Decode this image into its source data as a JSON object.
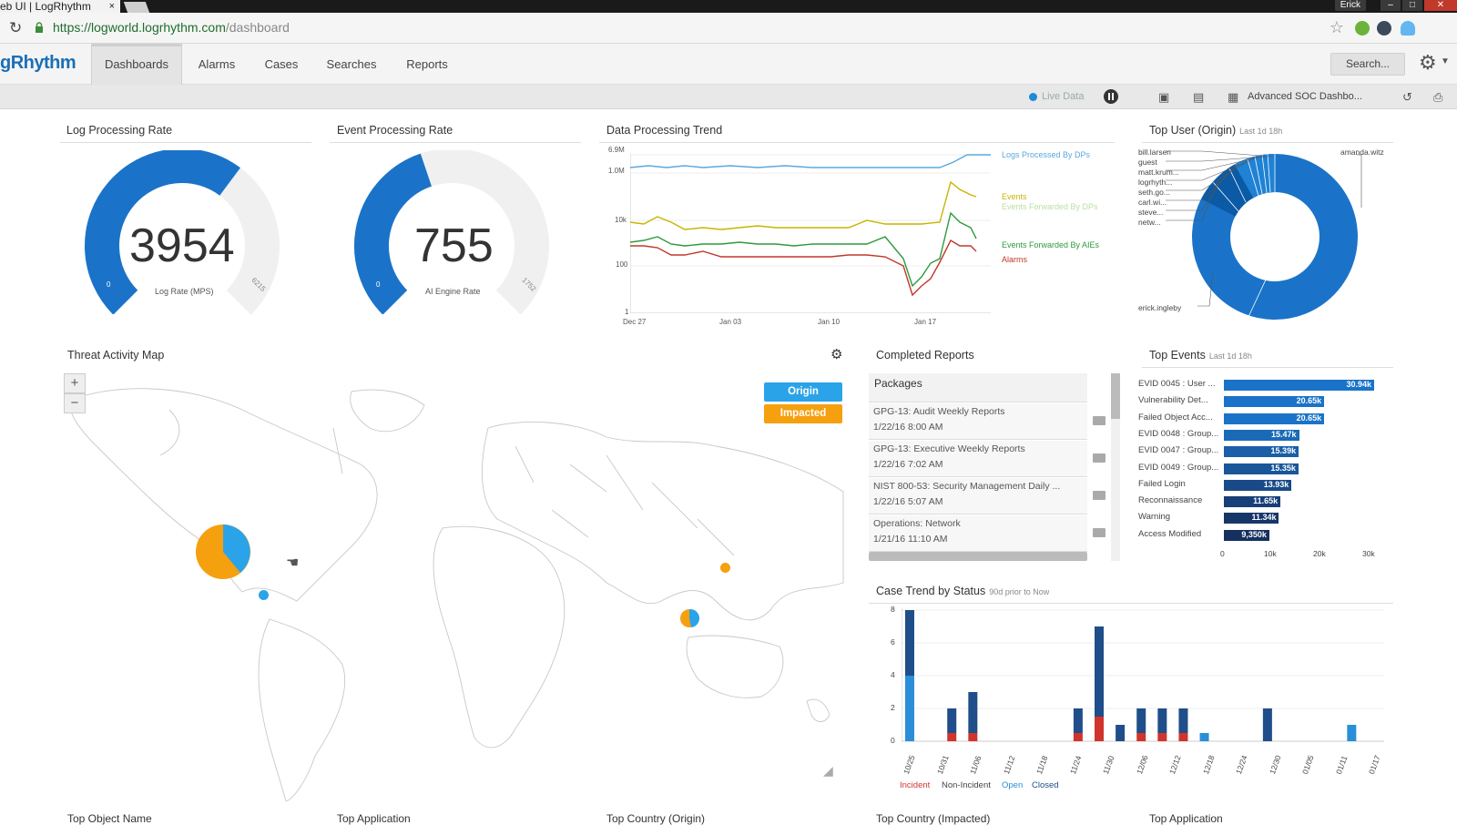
{
  "browser": {
    "tab_title": "eb UI | LogRhythm",
    "tab_close": "×",
    "user": "Erick",
    "url_host": "https://logworld.logrhythm.com",
    "url_path": "/dashboard"
  },
  "nav": {
    "logo": "gRhythm",
    "tabs": [
      "Dashboards",
      "Alarms",
      "Cases",
      "Searches",
      "Reports"
    ],
    "search_label": "Search..."
  },
  "toolbar": {
    "live_label": "Live Data",
    "dashboard_name": "Advanced SOC Dashbo..."
  },
  "log_rate": {
    "title": "Log Processing Rate",
    "value": "3954",
    "label": "Log Rate (MPS)",
    "min": "0",
    "max": "6215",
    "fraction": 0.636,
    "color": "#1a73c8"
  },
  "event_rate": {
    "title": "Event Processing Rate",
    "value": "755",
    "label": "AI Engine Rate",
    "min": "0",
    "max": "1752",
    "fraction": 0.431,
    "color": "#1a73c8"
  },
  "trend": {
    "title": "Data Processing Trend",
    "y_ticks": [
      "6.9M",
      "1.0M",
      "10k",
      "100",
      "1"
    ],
    "x_ticks": [
      "Dec 27",
      "Jan 03",
      "Jan 10",
      "Jan 17"
    ],
    "legend": [
      {
        "name": "Logs Processed By DPs",
        "color": "#5aa8e0"
      },
      {
        "name": "Events",
        "color": "#c8b400"
      },
      {
        "name": "Events Forwarded By DPs",
        "color": "#b9dfa0"
      },
      {
        "name": "Events Forwarded By AIEs",
        "color": "#2e9a3c"
      },
      {
        "name": "Alarms",
        "color": "#c0392b"
      }
    ]
  },
  "top_user": {
    "title": "Top User (Origin)",
    "subtitle": "Last 1d 18h",
    "users": [
      "bill.larsen",
      "guest",
      "matt.krum...",
      "logrhyth...",
      "seth.go...",
      "carl.wi...",
      "steve...",
      "netw..."
    ],
    "right_user": "amanda.witz",
    "bottom_user": "erick.ingleby"
  },
  "threat_map": {
    "title": "Threat Activity Map",
    "zoom_in": "+",
    "zoom_out": "−",
    "origin_label": "Origin",
    "impacted_label": "Impacted",
    "origin_color": "#2ba3e8",
    "impacted_color": "#f5a00f"
  },
  "reports": {
    "title": "Completed Reports",
    "header": "Packages",
    "items": [
      {
        "name": "GPG-13: Audit Weekly Reports",
        "date": "1/22/16 8:00 AM"
      },
      {
        "name": "GPG-13: Executive Weekly Reports",
        "date": "1/22/16 7:02 AM"
      },
      {
        "name": "NIST 800-53: Security Management Daily ...",
        "date": "1/22/16 5:07 AM"
      },
      {
        "name": "Operations: Network",
        "date": "1/21/16 11:10 AM"
      }
    ]
  },
  "top_events": {
    "title": "Top Events",
    "subtitle": "Last 1d 18h",
    "axis": [
      "0",
      "10k",
      "20k",
      "30k"
    ]
  },
  "case_trend": {
    "title": "Case Trend by Status",
    "subtitle": "90d prior to Now",
    "legend": [
      {
        "name": "Incident",
        "color": "#d0342c"
      },
      {
        "name": "Non-Incident",
        "color": "#444444"
      },
      {
        "name": "Open",
        "color": "#2a8fd8"
      },
      {
        "name": "Closed",
        "color": "#1f4e8a"
      }
    ]
  },
  "bottom_titles": [
    "Top Object Name",
    "Top Application",
    "Top Country (Origin)",
    "Top Country (Impacted)",
    "Top Application"
  ],
  "chart_data": [
    {
      "type": "bar",
      "title": "Top Events",
      "categories": [
        "EVID 0045 : User ...",
        "Vulnerability Det...",
        "Failed Object Acc...",
        "EVID 0048 : Group...",
        "EVID 0047 : Group...",
        "EVID 0049 : Group...",
        "Failed Login",
        "Reconnaissance",
        "Warning",
        "Access Modified"
      ],
      "values": [
        30940,
        20650,
        20650,
        15470,
        15390,
        15350,
        13930,
        11650,
        11340,
        9350
      ],
      "data_labels": [
        "30.94k",
        "20.65k",
        "20.65k",
        "15.47k",
        "15.39k",
        "15.35k",
        "13.93k",
        "11.65k",
        "11.34k",
        "9,350k"
      ],
      "xlim": [
        0,
        30000
      ],
      "colors": [
        "#1a73c8",
        "#1a73c8",
        "#1a73c8",
        "#1a6ab8",
        "#1a5fa8",
        "#19569a",
        "#184a88",
        "#173f78",
        "#163668",
        "#153060"
      ]
    },
    {
      "type": "bar",
      "title": "Case Trend by Status",
      "categories": [
        "10/25",
        "10/31",
        "11/06",
        "11/12",
        "11/18",
        "11/24",
        "11/30",
        "12/06",
        "12/12",
        "12/18",
        "12/24",
        "12/30",
        "01/05",
        "01/11",
        "01/17"
      ],
      "y_ticks": [
        "0",
        "2",
        "4",
        "6",
        "8"
      ],
      "ylim": [
        0,
        8
      ],
      "series": [
        {
          "name": "Incident",
          "values": [
            0,
            0.5,
            0.5,
            0,
            0,
            0.5,
            1.5,
            0,
            0.5,
            0.5,
            0.5,
            0,
            0,
            0
          ]
        },
        {
          "name": "Open",
          "values": [
            4,
            0,
            0,
            0,
            0,
            0,
            0,
            0,
            0,
            0,
            0,
            0.5,
            0,
            0,
            1
          ]
        },
        {
          "name": "Closed",
          "values": [
            4,
            1.5,
            2.5,
            0,
            0,
            1.5,
            5.5,
            1,
            1.5,
            1.5,
            1.5,
            0,
            0,
            2
          ]
        }
      ]
    }
  ]
}
